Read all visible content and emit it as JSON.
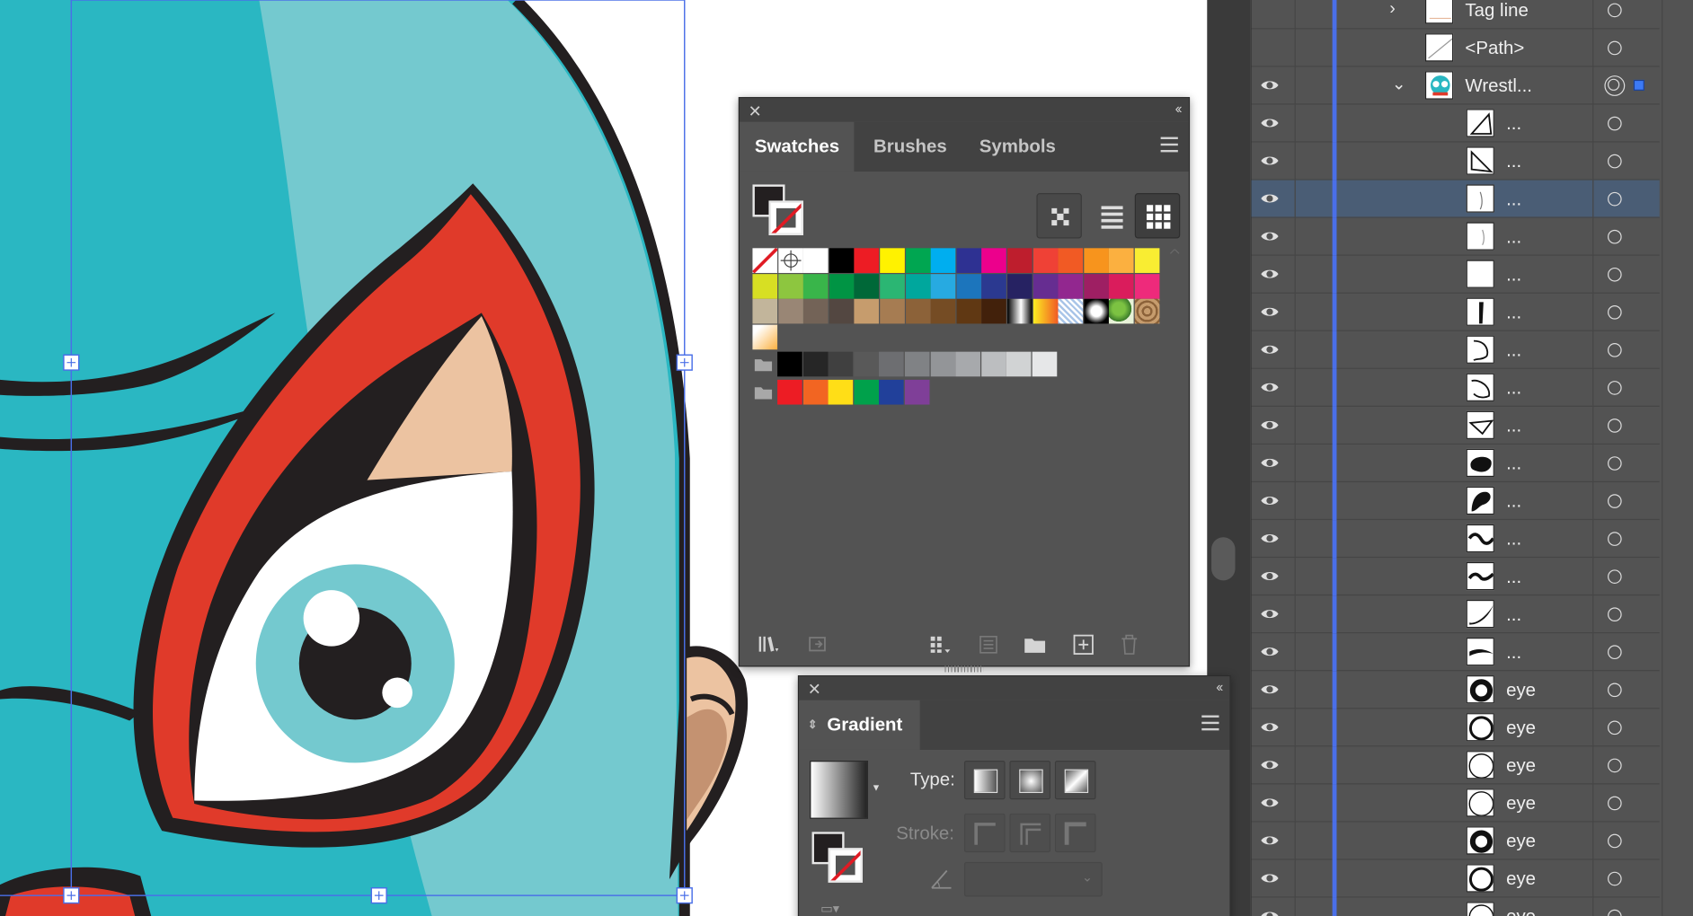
{
  "colors": {
    "accent": "#4a6fe8",
    "panel_bg": "#535353",
    "panel_dark": "#424242",
    "selection": "#4a5d75"
  },
  "swatches_panel": {
    "tabs": [
      "Swatches",
      "Brushes",
      "Symbols"
    ],
    "active_tab": "Swatches",
    "close_icon": "close-icon",
    "collapse_icon": "double-chevron-left-icon",
    "menu_icon": "hamburger-menu-icon",
    "view_buttons": [
      "show-kinds-icon",
      "list-view-icon",
      "grid-view-icon"
    ],
    "swatch_rows": [
      [
        "none",
        "registration",
        "#ffffff",
        "#000000",
        "#ed1c24",
        "#fff200",
        "#00a651",
        "#00aeef",
        "#2e3192",
        "#ec008c",
        "#be1e2d",
        "#ef4136",
        "#f15a24",
        "#f7941d",
        "#fbb040",
        "#f9ed32"
      ],
      [
        "#d7df23",
        "#8dc63f",
        "#39b54a",
        "#009444",
        "#006838",
        "#2bb673",
        "#00a79d",
        "#27aae1",
        "#1c75bc",
        "#2b3990",
        "#262262",
        "#662d91",
        "#92278f",
        "#9e1f63",
        "#da1c5c",
        "#ee2a7b"
      ],
      [
        "#c2b59b",
        "#998675",
        "#736357",
        "#534741",
        "#c69c6d",
        "#a67c52",
        "#8c6239",
        "#754c24",
        "#603813",
        "#42210b",
        "gradient-bw",
        "gradient-orange",
        "pattern-grid",
        "gradient-radial",
        "pattern-leaf",
        "pattern-brown"
      ],
      [
        "gradient-yellow"
      ]
    ],
    "grayscale_group": [
      "#000000",
      "#262626",
      "#404040",
      "#595959",
      "#6d6e71",
      "#808285",
      "#939598",
      "#a7a9ac",
      "#bcbec0",
      "#d1d3d4",
      "#e6e7e8"
    ],
    "bright_group": [
      "#ed1c24",
      "#f26522",
      "#ffde17",
      "#00a14b",
      "#21409a",
      "#7f3f98"
    ],
    "bottom_icons": [
      "swatch-libraries-icon",
      "place-swatch-icon",
      "show-swatch-kinds-icon",
      "swatch-options-icon",
      "new-color-group-icon",
      "new-swatch-icon",
      "delete-icon"
    ]
  },
  "gradient_panel": {
    "title": "Gradient",
    "type_label": "Type:",
    "stroke_label": "Stroke:",
    "type_buttons": [
      "linear-gradient-icon",
      "radial-gradient-icon",
      "freeform-gradient-icon"
    ],
    "stroke_buttons": [
      "stroke-within-icon",
      "stroke-along-icon",
      "stroke-across-icon"
    ],
    "angle_icon": "angle-icon"
  },
  "layers_panel": {
    "rows": [
      {
        "name": "Tag line",
        "visible": false,
        "indent": 1,
        "disclosure": "collapsed",
        "thumb": "tagline"
      },
      {
        "name": "<Path>",
        "visible": false,
        "indent": 1,
        "disclosure": "",
        "thumb": "path"
      },
      {
        "name": "Wrestl...",
        "visible": true,
        "indent": 1,
        "disclosure": "expanded",
        "thumb": "wrestler",
        "targeted": true
      },
      {
        "name": "...",
        "visible": true,
        "indent": 2,
        "thumb": "s1"
      },
      {
        "name": "...",
        "visible": true,
        "indent": 2,
        "thumb": "s2"
      },
      {
        "name": "...",
        "visible": true,
        "indent": 2,
        "thumb": "s3",
        "selected": true
      },
      {
        "name": "...",
        "visible": true,
        "indent": 2,
        "thumb": "s4"
      },
      {
        "name": "...",
        "visible": true,
        "indent": 2,
        "thumb": "blank"
      },
      {
        "name": "...",
        "visible": true,
        "indent": 2,
        "thumb": "s6"
      },
      {
        "name": "...",
        "visible": true,
        "indent": 2,
        "thumb": "s7"
      },
      {
        "name": "...",
        "visible": true,
        "indent": 2,
        "thumb": "s8"
      },
      {
        "name": "...",
        "visible": true,
        "indent": 2,
        "thumb": "s9"
      },
      {
        "name": "...",
        "visible": true,
        "indent": 2,
        "thumb": "blob1"
      },
      {
        "name": "...",
        "visible": true,
        "indent": 2,
        "thumb": "blob2"
      },
      {
        "name": "...",
        "visible": true,
        "indent": 2,
        "thumb": "wave1"
      },
      {
        "name": "...",
        "visible": true,
        "indent": 2,
        "thumb": "wave2"
      },
      {
        "name": "...",
        "visible": true,
        "indent": 2,
        "thumb": "stroke1"
      },
      {
        "name": "...",
        "visible": true,
        "indent": 2,
        "thumb": "stroke2"
      },
      {
        "name": "eye",
        "visible": true,
        "indent": 2,
        "thumb": "eye-thick"
      },
      {
        "name": "eye",
        "visible": true,
        "indent": 2,
        "thumb": "eye-ring"
      },
      {
        "name": "eye",
        "visible": true,
        "indent": 2,
        "thumb": "eye-thin"
      },
      {
        "name": "eye",
        "visible": true,
        "indent": 2,
        "thumb": "eye-thin"
      },
      {
        "name": "eye",
        "visible": true,
        "indent": 2,
        "thumb": "eye-thick"
      },
      {
        "name": "eye",
        "visible": true,
        "indent": 2,
        "thumb": "eye-ring"
      },
      {
        "name": "eye",
        "visible": true,
        "indent": 2,
        "thumb": "eye-thin"
      }
    ]
  }
}
